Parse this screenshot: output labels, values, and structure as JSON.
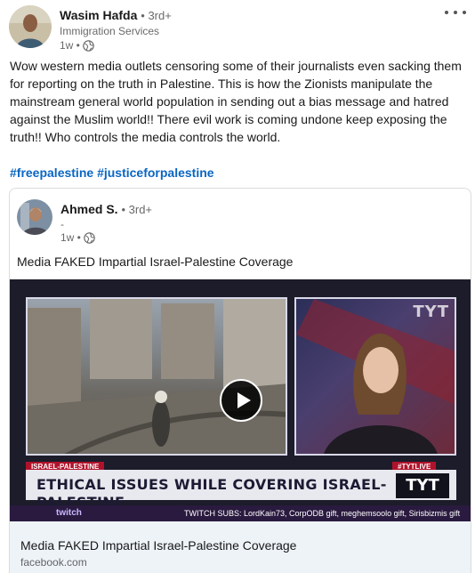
{
  "post": {
    "author": {
      "name": "Wasim Hafda",
      "degree": "• 3rd+",
      "headline": "Immigration Services",
      "time": "1w •"
    },
    "commentary": "Wow western media outlets censoring some of their journalists even sacking them for reporting on the truth in Palestine. This is how the Zionists manipulate the mainstream general world population in sending out a bias message and hatred against the Muslim world!! There evil work is coming undone keep exposing the truth!! Who controls the media controls the world.",
    "hashtags": [
      "#freepalestine",
      "#justiceforpalestine"
    ],
    "menu_icon": "ellipsis-icon"
  },
  "shared": {
    "author": {
      "name": "Ahmed S.",
      "degree": "• 3rd+",
      "headline": "-",
      "time": "1w •"
    },
    "commentary": "Media FAKED Impartial Israel-Palestine Coverage",
    "video": {
      "tag_left": "ISRAEL-PALESTINE",
      "tag_right": "#TYTLIVE",
      "headline": "ETHICAL ISSUES WHILE COVERING ISRAEL-PALESTINE",
      "logo": "TYT",
      "corner_logo": "TYT",
      "ticker_brand": "twitch",
      "ticker_text": "TWITCH SUBS: LordKain73, CorpODB gift, meghemsoolo gift, Sirisbizmis gift",
      "play_icon": "play-icon"
    },
    "link": {
      "title": "Media FAKED Impartial Israel-Palestine Coverage",
      "source": "facebook.com"
    }
  },
  "colors": {
    "hashtag": "#0a66c2",
    "link_card_bg": "#eef3f8",
    "tyt_red": "#b1122b"
  }
}
